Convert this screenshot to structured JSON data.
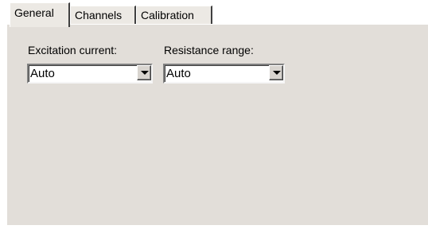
{
  "tabs": [
    {
      "label": "General",
      "active": true
    },
    {
      "label": "Channels",
      "active": false
    },
    {
      "label": "Calibration",
      "active": false
    }
  ],
  "general": {
    "excitation_current": {
      "label": "Excitation current:",
      "value": "Auto"
    },
    "resistance_range": {
      "label": "Resistance range:",
      "value": "Auto"
    }
  },
  "icons": {
    "dropdown": "chevron-down-icon"
  },
  "colors": {
    "panel_background": "#e2ded9",
    "window_background": "#ffffff"
  }
}
